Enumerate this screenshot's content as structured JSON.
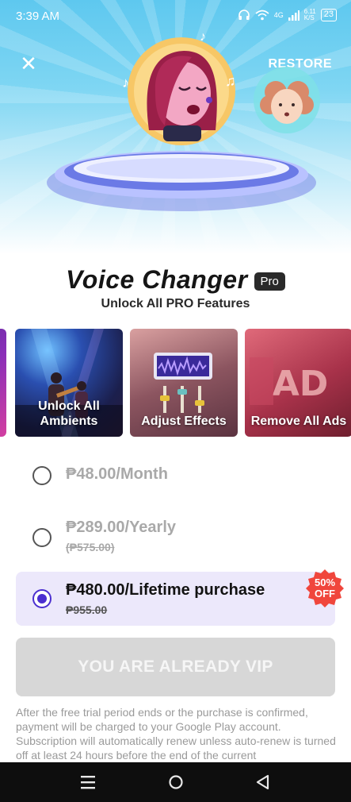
{
  "status_bar": {
    "time": "3:39 AM",
    "network": "4G",
    "speed": "6.11\nK/S",
    "battery": "23"
  },
  "header": {
    "restore_label": "RESTORE"
  },
  "title": {
    "app_name": "Voice Changer",
    "badge": "Pro",
    "subtitle": "Unlock All PRO Features"
  },
  "features": [
    {
      "label": "Unlock All Ambients"
    },
    {
      "label": "Adjust Effects"
    },
    {
      "label": "Remove All Ads"
    }
  ],
  "plans": [
    {
      "price": "₱48.00/Month",
      "old_price": "",
      "selected": false
    },
    {
      "price": "₱289.00/Yearly",
      "old_price": "(₱575.00)",
      "selected": false
    },
    {
      "price": "₱480.00/Lifetime purchase",
      "old_price": "₱955.00",
      "selected": true,
      "badge": "50% OFF"
    }
  ],
  "cta": {
    "label": "YOU ARE ALREADY VIP"
  },
  "legal_text": "After the free trial period ends or the purchase is confirmed, payment will be charged to your Google Play account. Subscription will automatically renew unless auto-renew is turned off at least 24 hours before the end of the current",
  "colors": {
    "accent": "#4b2fd0",
    "selected_plan_bg": "#ece8fb",
    "discount_badge": "#f0463c",
    "disabled_button": "#d7d7d7"
  }
}
